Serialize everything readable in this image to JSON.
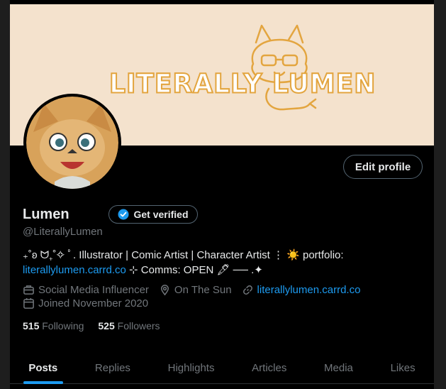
{
  "banner": {
    "title": "LITERALLY LUMEN"
  },
  "profile": {
    "name": "Lumen",
    "verify_label": "Get verified",
    "handle": "@LiterallyLumen",
    "edit_label": "Edit profile"
  },
  "bio": {
    "part1": "₊˚ʚ ᗢ₊˚✧ ﾟ. Illustrator | Comic Artist | Character Artist ⋮ ☀️ portfolio:",
    "link": "literallylumen.carrd.co",
    "part2": " ⊹ Comms: OPEN 🖋 ── .✦"
  },
  "meta": {
    "category": "Social Media Influencer",
    "location": "On The Sun",
    "website": "literallylumen.carrd.co",
    "joined": "Joined November 2020"
  },
  "stats": {
    "following_count": "515",
    "following_label": "Following",
    "followers_count": "525",
    "followers_label": "Followers"
  },
  "tabs": [
    "Posts",
    "Replies",
    "Highlights",
    "Articles",
    "Media",
    "Likes"
  ],
  "colors": {
    "accent": "#1d9bf0",
    "banner_bg": "#f4e2cd",
    "banner_ink": "#e3a53f"
  },
  "icons": [
    "briefcase-icon",
    "location-pin-icon",
    "link-icon",
    "calendar-icon",
    "verified-badge-icon"
  ]
}
